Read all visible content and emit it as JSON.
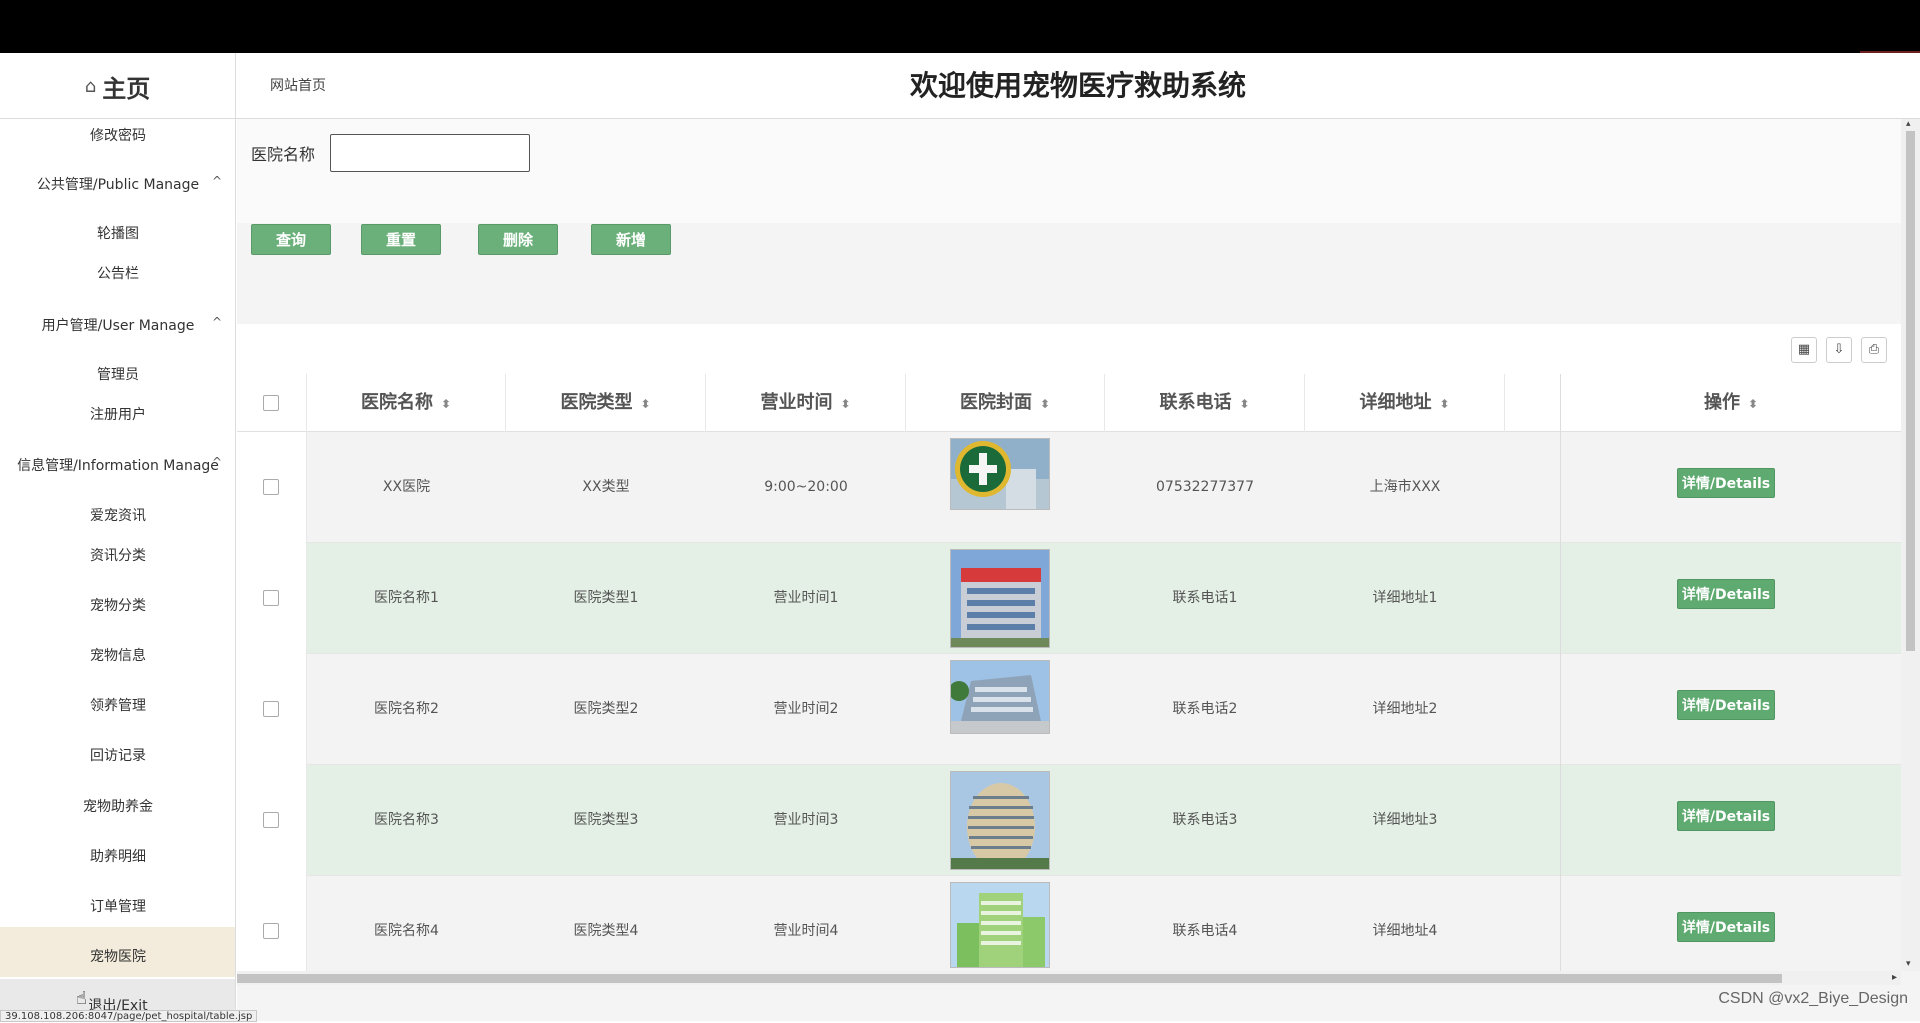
{
  "header": {
    "home_icon": "home-icon",
    "home_label": "主页",
    "site_link": "网站首页",
    "system_title": "欢迎使用宠物医疗救助系统"
  },
  "sidebar": {
    "items": [
      {
        "label": "修改密码",
        "type": "item"
      },
      {
        "label": "公共管理/Public Manage",
        "type": "group"
      },
      {
        "label": "轮播图",
        "type": "item"
      },
      {
        "label": "公告栏",
        "type": "item"
      },
      {
        "label": "用户管理/User Manage",
        "type": "group"
      },
      {
        "label": "管理员",
        "type": "item"
      },
      {
        "label": "注册用户",
        "type": "item"
      },
      {
        "label": "信息管理/Information Manage",
        "type": "group"
      },
      {
        "label": "爱宠资讯",
        "type": "item"
      },
      {
        "label": "资讯分类",
        "type": "item"
      },
      {
        "label": "宠物分类",
        "type": "item"
      },
      {
        "label": "宠物信息",
        "type": "item"
      },
      {
        "label": "领养管理",
        "type": "item"
      },
      {
        "label": "回访记录",
        "type": "item"
      },
      {
        "label": "宠物助养金",
        "type": "item"
      },
      {
        "label": "助养明细",
        "type": "item"
      },
      {
        "label": "订单管理",
        "type": "item"
      },
      {
        "label": "宠物医院",
        "type": "item",
        "active": true
      },
      {
        "label": "退出/Exit",
        "type": "item"
      }
    ],
    "group_chevron": "^"
  },
  "status_url": "39.108.108.206:8047/page/pet_hospital/table.jsp",
  "search": {
    "label": "医院名称",
    "value": "",
    "placeholder": ""
  },
  "buttons": {
    "query": "查询",
    "reset": "重置",
    "delete": "删除",
    "add": "新增"
  },
  "table": {
    "columns": [
      "医院名称",
      "医院类型",
      "营业时间",
      "医院封面",
      "联系电话",
      "详细地址",
      "操作"
    ],
    "sort_glyph": "⬍",
    "rows": [
      {
        "name": "XX医院",
        "type": "XX类型",
        "hours": "9:00~20:00",
        "phone": "07532277377",
        "address": "上海市XXX",
        "action": "详情/Details"
      },
      {
        "name": "医院名称1",
        "type": "医院类型1",
        "hours": "营业时间1",
        "phone": "联系电话1",
        "address": "详细地址1",
        "action": "详情/Details"
      },
      {
        "name": "医院名称2",
        "type": "医院类型2",
        "hours": "营业时间2",
        "phone": "联系电话2",
        "address": "详细地址2",
        "action": "详情/Details"
      },
      {
        "name": "医院名称3",
        "type": "医院类型3",
        "hours": "营业时间3",
        "phone": "联系电话3",
        "address": "详细地址3",
        "action": "详情/Details"
      },
      {
        "name": "医院名称4",
        "type": "医院类型4",
        "hours": "营业时间4",
        "phone": "联系电话4",
        "address": "详细地址4",
        "action": "详情/Details"
      }
    ]
  },
  "toolbar_icons": [
    "columns-icon",
    "export-icon",
    "print-icon"
  ],
  "watermark": "CSDN @vx2_Biye_Design",
  "colors": {
    "button_green": "#6bb07a",
    "row_green": "#e4f0e6",
    "active_sidebar": "#f3ecdc"
  }
}
